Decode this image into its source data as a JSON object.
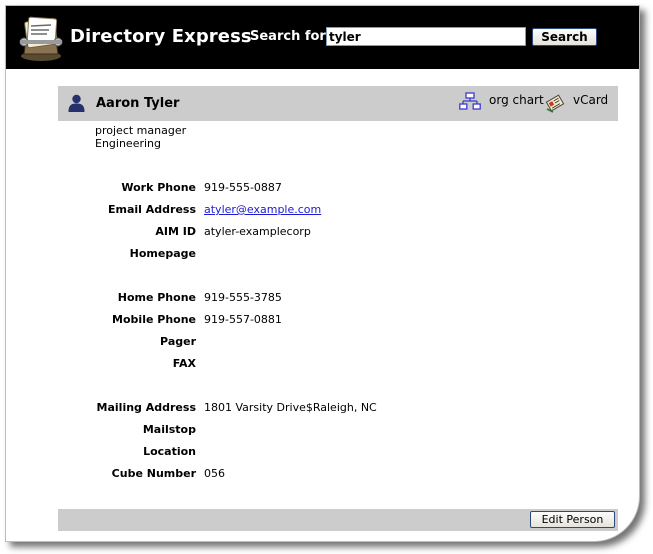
{
  "app": {
    "title": "Directory Express"
  },
  "search": {
    "label": "Search for:",
    "value": "tyler",
    "button_label": "Search"
  },
  "person": {
    "name": "Aaron Tyler",
    "job_title": "project manager",
    "department": "Engineering",
    "links": {
      "org_chart": "org chart",
      "vcard": "vCard"
    }
  },
  "fields": [
    {
      "label": "Work Phone",
      "value": "919-555-0887"
    },
    {
      "label": "Email Address",
      "value": "atyler@example.com",
      "is_link": true
    },
    {
      "label": "AIM ID",
      "value": "atyler-examplecorp"
    },
    {
      "label": "Homepage",
      "value": ""
    },
    {
      "label": "Home Phone",
      "value": "919-555-3785"
    },
    {
      "label": "Mobile Phone",
      "value": "919-557-0881"
    },
    {
      "label": "Pager",
      "value": ""
    },
    {
      "label": "FAX",
      "value": ""
    },
    {
      "label": "Mailing Address",
      "value": "1801 Varsity Drive$Raleigh, NC"
    },
    {
      "label": "Mailstop",
      "value": ""
    },
    {
      "label": "Location",
      "value": ""
    },
    {
      "label": "Cube Number",
      "value": "056"
    }
  ],
  "footer": {
    "edit_button_label": "Edit Person"
  },
  "icons": {
    "logo": "rolodex-logo-icon",
    "person": "person-icon",
    "org_chart": "org-chart-icon",
    "vcard": "vcard-icon"
  },
  "colors": {
    "header_bg": "#000000",
    "bar_bg": "#cccccc",
    "link": "#1a1ad8",
    "person_icon": "#26306b"
  }
}
